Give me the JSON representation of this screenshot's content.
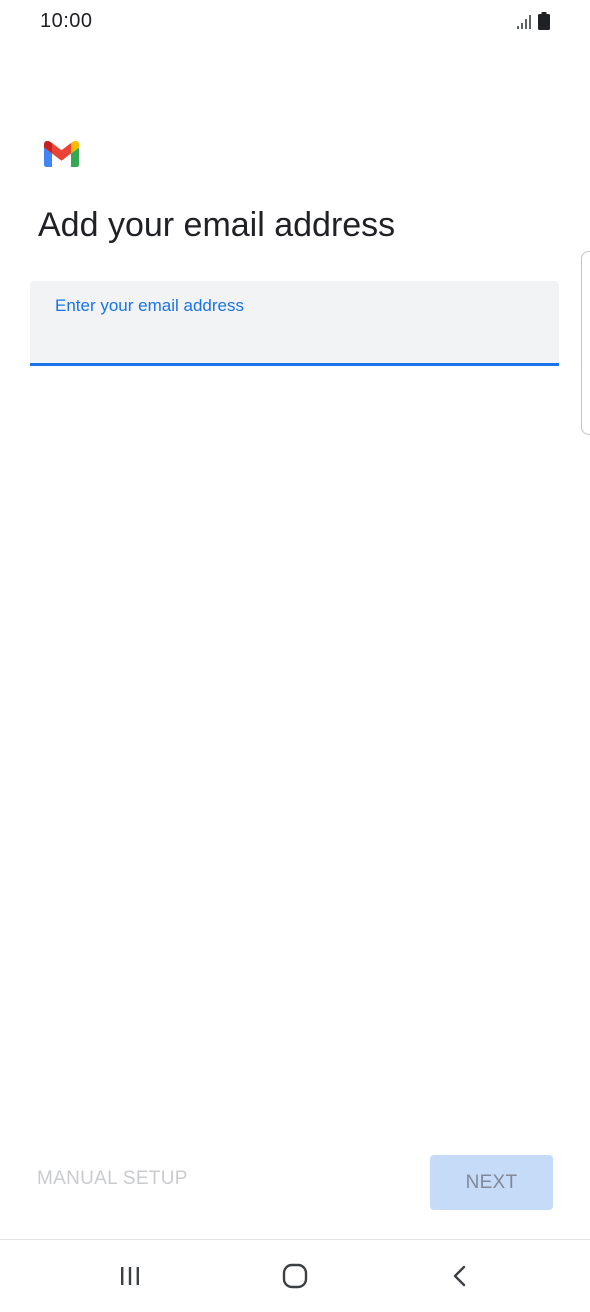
{
  "status_bar": {
    "time": "10:00",
    "icons": [
      "signal-icon",
      "battery-icon"
    ]
  },
  "app": {
    "logo": "gmail-logo",
    "colors": {
      "accent": "#1a73e8",
      "field_background": "#f1f3f4",
      "next_disabled_bg": "#c5dbf7",
      "text_disabled": "#c9cbce",
      "gmail_red": "#ea4335",
      "gmail_blue": "#4285f4",
      "gmail_green": "#34a853",
      "gmail_yellow": "#fbbc04"
    }
  },
  "main": {
    "title": "Add your email address",
    "email_field": {
      "label": "Enter your email address",
      "value": ""
    }
  },
  "actions": {
    "manual_setup_label": "MANUAL SETUP",
    "next_label": "NEXT"
  },
  "nav_bar": {
    "buttons": [
      "recent-apps-icon",
      "home-icon",
      "back-icon"
    ]
  }
}
